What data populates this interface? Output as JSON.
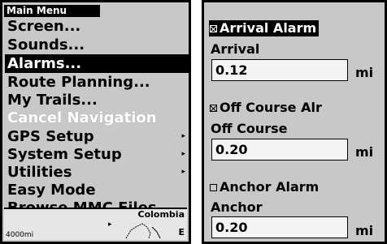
{
  "main_menu": {
    "title": "Main Menu",
    "items": [
      {
        "label": "Screen...",
        "state": "normal",
        "submenu": false
      },
      {
        "label": "Sounds...",
        "state": "normal",
        "submenu": false
      },
      {
        "label": "Alarms...",
        "state": "selected",
        "submenu": false
      },
      {
        "label": "Route Planning...",
        "state": "normal",
        "submenu": false
      },
      {
        "label": "My Trails...",
        "state": "normal",
        "submenu": false
      },
      {
        "label": "Cancel Navigation",
        "state": "disabled",
        "submenu": false
      },
      {
        "label": "GPS Setup",
        "state": "normal",
        "submenu": true
      },
      {
        "label": "System Setup",
        "state": "normal",
        "submenu": true
      },
      {
        "label": "Utilities",
        "state": "normal",
        "submenu": true
      },
      {
        "label": "Easy Mode",
        "state": "normal",
        "submenu": false
      },
      {
        "label": "Browse MMC Files...",
        "state": "normal",
        "submenu": false
      }
    ],
    "submenu_arrow": "▸"
  },
  "map": {
    "country_label": "Colombia",
    "scale_label": "4000mi",
    "edge_label": "E",
    "cursor_glyph": "▸"
  },
  "alarms": {
    "arrival": {
      "toggle_label": "Arrival Alarm",
      "checked": true,
      "selected": true,
      "field_label": "Arrival",
      "value": "0.12",
      "unit": "mi"
    },
    "off_course": {
      "toggle_label": "Off Course Alr",
      "checked": true,
      "selected": false,
      "field_label": "Off Course",
      "value": "0.20",
      "unit": "mi"
    },
    "anchor": {
      "toggle_label": "Anchor Alarm",
      "checked": false,
      "selected": false,
      "field_label": "Anchor",
      "value": "0.20",
      "unit": "mi"
    }
  },
  "colors": {
    "panel_bg": "#c8c8c8",
    "highlight": "#000000",
    "highlight_text": "#ffffff",
    "field_bg": "#f4f4f4"
  }
}
